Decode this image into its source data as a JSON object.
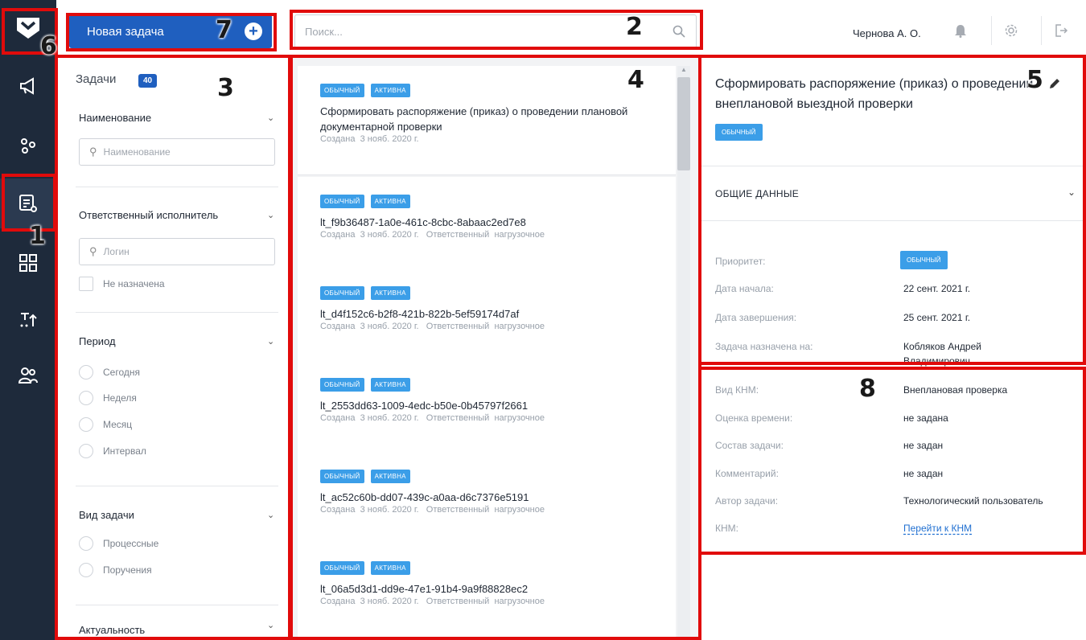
{
  "header": {
    "new_task_label": "Новая задача",
    "new_task_icon": "plus-circle-icon",
    "search_placeholder": "Поиск...",
    "user_name": "Чернова А. О.",
    "icons": [
      "bell-icon",
      "gear-icon",
      "logout-icon"
    ]
  },
  "rail": {
    "items": [
      "megaphone-icon",
      "gears-icon",
      "task-list-icon",
      "dashboard-icon",
      "flow-icon",
      "users-icon"
    ]
  },
  "filters": {
    "title": "Задачи",
    "count": "40",
    "name_section": "Наименование",
    "name_placeholder": "Наименование",
    "assignee_section": "Ответственный исполнитель",
    "login_placeholder": "Логин",
    "unassigned": "Не назначена",
    "period_section": "Период",
    "period_options": [
      "Сегодня",
      "Неделя",
      "Месяц",
      "Интервал"
    ],
    "type_section": "Вид задачи",
    "type_options": [
      "Процессные",
      "Поручения"
    ],
    "relevance_section": "Актуальность"
  },
  "list": {
    "badge_priority": "ОБЫЧНЫЙ",
    "badge_status": "АКТИВНА",
    "created_label": "Создана",
    "assignee_label": "Ответственный",
    "items": [
      {
        "title": "Сформировать распоряжение (приказ) о проведении плановой документарной проверки",
        "date": "3 нояб. 2020 г.",
        "assignee": ""
      },
      {
        "title": "lt_f9b36487-1a0e-461c-8cbc-8abaac2ed7e8",
        "date": "3 нояб. 2020 г.",
        "assignee": "нагрузочное"
      },
      {
        "title": "lt_d4f152c6-b2f8-421b-822b-5ef59174d7af",
        "date": "3 нояб. 2020 г.",
        "assignee": "нагрузочное"
      },
      {
        "title": "lt_2553dd63-1009-4edc-b50e-0b45797f2661",
        "date": "3 нояб. 2020 г.",
        "assignee": "нагрузочное"
      },
      {
        "title": "lt_ac52c60b-dd07-439c-a0aa-d6c7376e5191",
        "date": "3 нояб. 2020 г.",
        "assignee": "нагрузочное"
      },
      {
        "title": "lt_06a5d3d1-dd9e-47e1-91b4-9a9f88828ec2",
        "date": "3 нояб. 2020 г.",
        "assignee": "нагрузочное"
      }
    ]
  },
  "details": {
    "title": "Сформировать распоряжение (приказ) о проведении внеплановой выездной проверки",
    "badge": "ОБЫЧНЫЙ",
    "section": "ОБЩИЕ ДАННЫЕ",
    "rows": [
      {
        "label": "Приоритет:",
        "value": "ОБЫЧНЫЙ"
      },
      {
        "label": "Дата начала:",
        "value": "22 сент. 2021 г."
      },
      {
        "label": "Дата завершения:",
        "value": "25 сент. 2021 г."
      },
      {
        "label": "Задача назначена на:",
        "value": "Кобляков Андрей Владимирович"
      },
      {
        "label": "Вид КНМ:",
        "value": "Внеплановая проверка"
      },
      {
        "label": "Оценка времени:",
        "value": "не задана"
      },
      {
        "label": "Состав задачи:",
        "value": "не задан"
      },
      {
        "label": "Комментарий:",
        "value": "не задан"
      },
      {
        "label": "Автор задачи:",
        "value": "Технологический пользователь"
      },
      {
        "label": "КНМ:",
        "value": "Перейти к КНМ"
      }
    ]
  },
  "annotations": [
    "1",
    "2",
    "3",
    "4",
    "5",
    "6",
    "7",
    "8"
  ],
  "colors": {
    "rail": "#1e2a3b",
    "primary": "#1f5fbf",
    "badge": "#3b9ee8",
    "highlight": "#e10b0b"
  }
}
